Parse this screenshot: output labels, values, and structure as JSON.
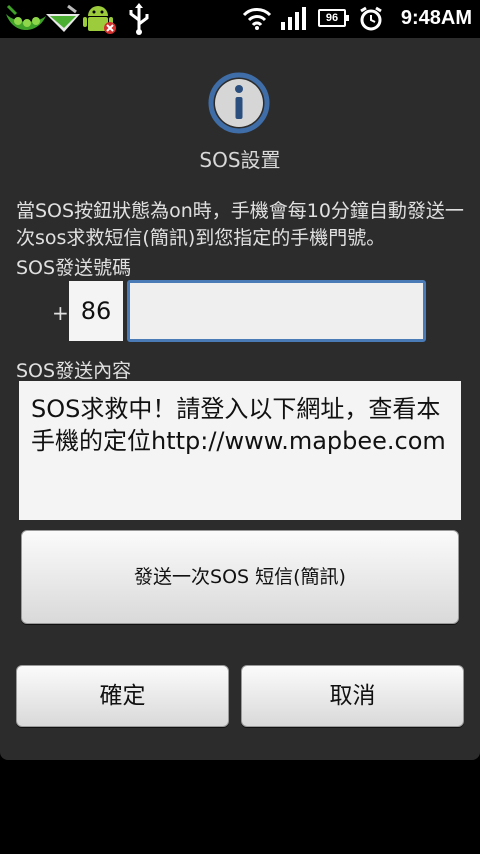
{
  "status_bar": {
    "time": "9:48AM",
    "battery_level": "96",
    "icons": [
      "pea-pod-icon",
      "notification-icon",
      "android-debug-icon",
      "usb-icon",
      "wifi-icon",
      "signal-icon",
      "battery-icon",
      "alarm-icon"
    ]
  },
  "dialog": {
    "icon": "info-icon",
    "title": "SOS設置",
    "description": "當SOS按鈕狀態為on時，手機會每10分鐘自動發送一次sos求救短信(簡訊)到您指定的手機門號。",
    "number_label": "SOS發送號碼",
    "plus_sign": "+",
    "country_code": "86",
    "phone_value": "",
    "content_label": "SOS發送內容",
    "message": "SOS求救中！請登入以下網址，查看本手機的定位http://www.mapbee.com",
    "send_once_label": "發送一次SOS 短信(簡訊)",
    "ok_label": "確定",
    "cancel_label": "取消"
  },
  "colors": {
    "dialog_bg": "#2c2c2c",
    "input_focus": "#4a7bb7",
    "info_icon": "#3f6da8"
  }
}
